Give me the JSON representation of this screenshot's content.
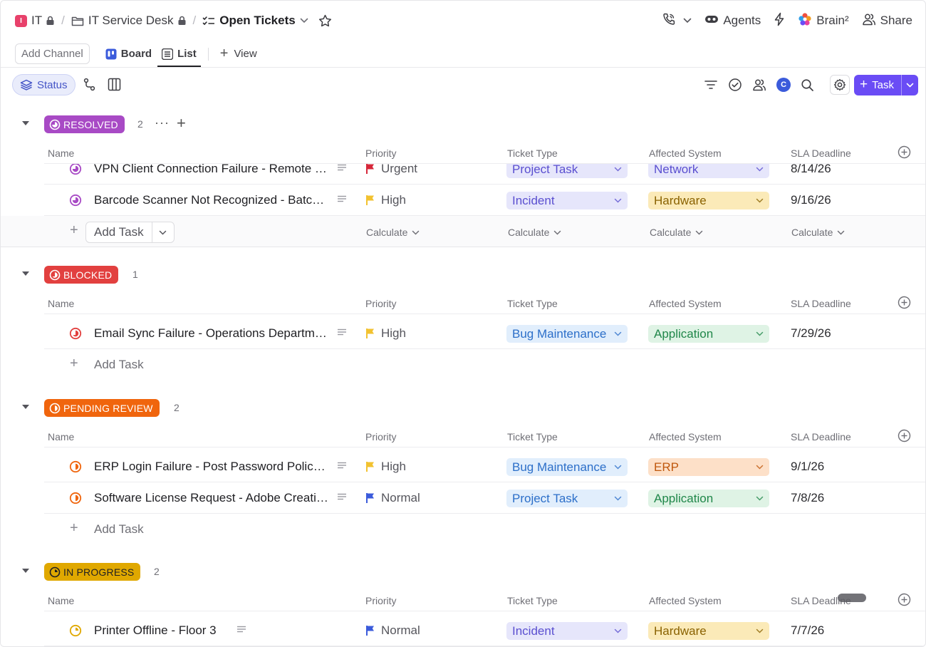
{
  "breadcrumb": {
    "workspace_badge": "I",
    "workspace": "IT",
    "space": "IT Service Desk",
    "current": "Open Tickets"
  },
  "header_right": {
    "agents": "Agents",
    "brain": "Brain²",
    "share": "Share"
  },
  "views": {
    "add_channel": "Add Channel",
    "board": "Board",
    "list": "List",
    "add_view": "View"
  },
  "toolbar": {
    "status_label": "Status",
    "avatar_initial": "C",
    "task_button": "Task"
  },
  "columns": {
    "name": "Name",
    "priority": "Priority",
    "ticket_type": "Ticket Type",
    "affected_system": "Affected System",
    "sla_deadline": "SLA Deadline"
  },
  "add_task_label": "Add Task",
  "calculate_label": "Calculate",
  "colors": {
    "accent": "#6a4cf5",
    "resolved": "#a84ac5",
    "blocked": "#e2403f",
    "pending_review": "#f0650d",
    "in_progress": "#e0a800",
    "flag_urgent": "#d6273a",
    "flag_high": "#f2c230",
    "flag_normal": "#3b5bdb"
  },
  "groups": [
    {
      "status": "RESOLVED",
      "count": "2",
      "rows": [
        {
          "name": "VPN Client Connection Failure - Remote Users",
          "priority": "Urgent",
          "ticket_type": "Project Task",
          "affected_system": "Network",
          "sla": "8/14/26"
        },
        {
          "name": "Barcode Scanner Not Recognized - Batch Station",
          "priority": "High",
          "ticket_type": "Incident",
          "affected_system": "Hardware",
          "sla": "9/16/26"
        }
      ]
    },
    {
      "status": "BLOCKED",
      "count": "1",
      "rows": [
        {
          "name": "Email Sync Failure - Operations Department",
          "priority": "High",
          "ticket_type": "Bug Maintenance",
          "affected_system": "Application",
          "sla": "7/29/26"
        }
      ]
    },
    {
      "status": "PENDING REVIEW",
      "count": "2",
      "rows": [
        {
          "name": "ERP Login Failure - Post Password Policy Change",
          "priority": "High",
          "ticket_type": "Bug Maintenance",
          "affected_system": "ERP",
          "sla": "9/1/26"
        },
        {
          "name": "Software License Request - Adobe Creative Cloud",
          "priority": "Normal",
          "ticket_type": "Project Task",
          "affected_system": "Application",
          "sla": "7/8/26"
        }
      ]
    },
    {
      "status": "IN PROGRESS",
      "count": "2",
      "rows": [
        {
          "name": "Printer Offline - Floor 3",
          "priority": "Normal",
          "ticket_type": "Incident",
          "affected_system": "Hardware",
          "sla": "7/7/26"
        }
      ]
    }
  ]
}
